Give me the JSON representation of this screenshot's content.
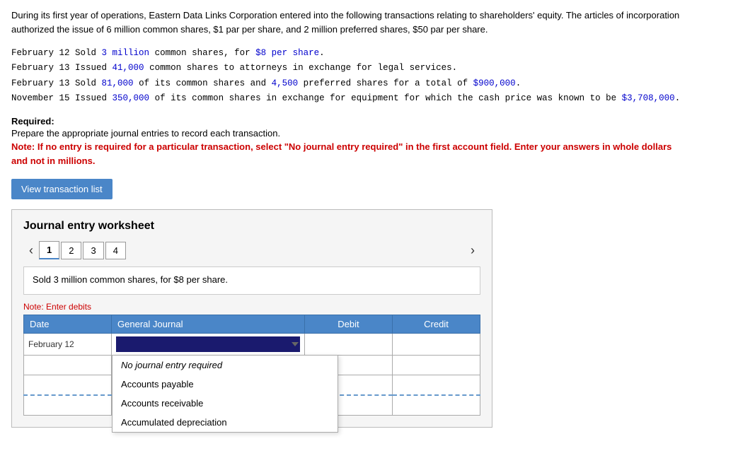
{
  "intro": {
    "text": "During its first year of operations, Eastern Data Links Corporation entered into the following transactions relating to shareholders' equity. The articles of incorporation authorized the issue of 6 million common shares, $1 par per share, and 2 million preferred shares, $50 par per share."
  },
  "transactions": [
    {
      "date": "February 12",
      "text": "Sold 3 million common shares, for $8 per share.",
      "highlighted": "Sold 3 million common shares, for $8 per share."
    },
    {
      "date": "February 13",
      "text": "Issued 41,000 common shares to attorneys in exchange for legal services.",
      "highlighted": "Issued 41,000 common shares to attorneys in exchange for legal services."
    },
    {
      "date": "February 13",
      "text": "Sold 81,000 of its common shares and 4,500 preferred shares for a total of $900,000.",
      "highlighted": "Sold 81,000 of its common shares and 4,500 preferred shares for a total of $900,000."
    },
    {
      "date": "November 15",
      "text": "Issued 350,000 of its common shares in exchange for equipment for which the cash price was known to be $3,708,000.",
      "highlighted": "Issued 350,000 of its common shares in exchange for equipment for which the cash price was known to be $3,708,000."
    }
  ],
  "required": {
    "label": "Required:",
    "subtitle": "Prepare the appropriate journal entries to record each transaction.",
    "note": "Note: If no entry is required for a particular transaction, select \"No journal entry required\" in the first account field. Enter your answers in whole dollars and not in millions."
  },
  "view_btn": "View transaction list",
  "worksheet": {
    "title": "Journal entry worksheet",
    "tabs": [
      "1",
      "2",
      "3",
      "4"
    ],
    "active_tab": 0,
    "entry_description": "Sold 3 million common shares, for $8 per share.",
    "note_label": "Note: Enter debits",
    "table": {
      "headers": [
        "Date",
        "General Journal",
        "Debit",
        "Credit"
      ],
      "rows": [
        {
          "date": "February 12",
          "account": "",
          "debit": "",
          "credit": ""
        },
        {
          "date": "",
          "account": "",
          "debit": "",
          "credit": ""
        },
        {
          "date": "",
          "account": "",
          "debit": "",
          "credit": ""
        },
        {
          "date": "",
          "account": "",
          "debit": "",
          "credit": ""
        }
      ]
    },
    "dropdown": {
      "items": [
        {
          "label": "No journal entry required",
          "type": "no-entry"
        },
        {
          "label": "Accounts payable",
          "type": "accounts"
        },
        {
          "label": "Accounts receivable",
          "type": "accounts"
        },
        {
          "label": "Accumulated depreciation",
          "type": "accounts"
        }
      ]
    }
  }
}
